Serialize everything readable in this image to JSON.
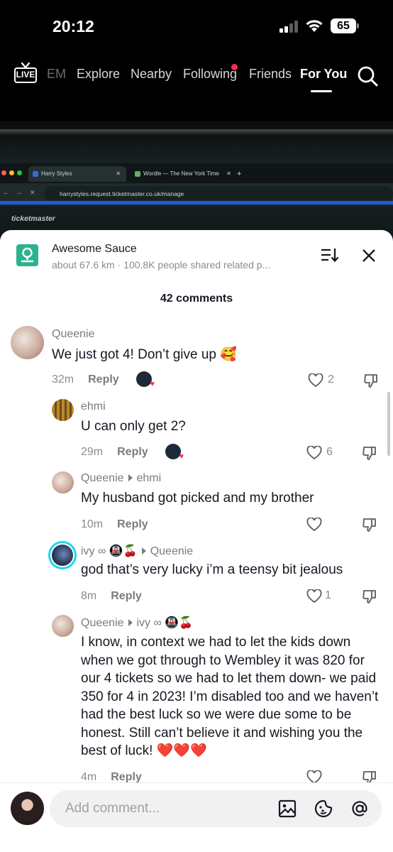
{
  "status_bar": {
    "time": "20:12",
    "battery": "65"
  },
  "nav": {
    "live_label": "LIVE",
    "items": [
      {
        "label": "EM"
      },
      {
        "label": "Explore"
      },
      {
        "label": "Nearby"
      },
      {
        "label": "Following"
      },
      {
        "label": "Friends"
      },
      {
        "label": "For You"
      }
    ]
  },
  "browser": {
    "tab1": "Harry Styles",
    "tab2": "Wordle — The New York Time",
    "tab_close": "✕",
    "new_tab": "+",
    "url": "harrystyles.request.ticketmaster.co.uk/manage",
    "site_logo": "ticketmaster"
  },
  "location": {
    "title": "Awesome Sauce",
    "subtitle": "about 67.6 km · 100.8K people shared related p..."
  },
  "comments_header": {
    "count_label": "42 comments"
  },
  "comments": [
    {
      "user": "Queenie",
      "text": "We just got 4! Don’t give up 🥰",
      "time": "32m",
      "reply_label": "Reply",
      "likes": "2"
    },
    {
      "user": "ehmi",
      "text": "U can only get 2?",
      "time": "29m",
      "reply_label": "Reply",
      "likes": "6"
    },
    {
      "user": "Queenie",
      "reply_to": "ehmi",
      "text": "My husband got picked and my brother",
      "time": "10m",
      "reply_label": "Reply",
      "likes": ""
    },
    {
      "user": "ivy ∞ 🚇🍒",
      "reply_to": "Queenie",
      "text": "god that’s very lucky i’m a teensy bit jealous",
      "time": "8m",
      "reply_label": "Reply",
      "likes": "1"
    },
    {
      "user": "Queenie",
      "reply_to": "ivy ∞ 🚇🍒",
      "text": "I know, in context we had to let the kids down when we got through to Wembley it was 820 for our 4 tickets so we had to let them down- we paid 350 for 4 in 2023! I’m disabled too and we haven’t had the best luck so we were due some to be honest. Still can’t believe it and wishing you the best of luck! ❤️❤️❤️",
      "time": "4m",
      "reply_label": "Reply",
      "likes": ""
    }
  ],
  "composer": {
    "placeholder": "Add comment..."
  },
  "colors": {
    "accent": "#fe2c55",
    "location_icon": "#2bb38e",
    "browser_bar": "#1f5bd6"
  }
}
